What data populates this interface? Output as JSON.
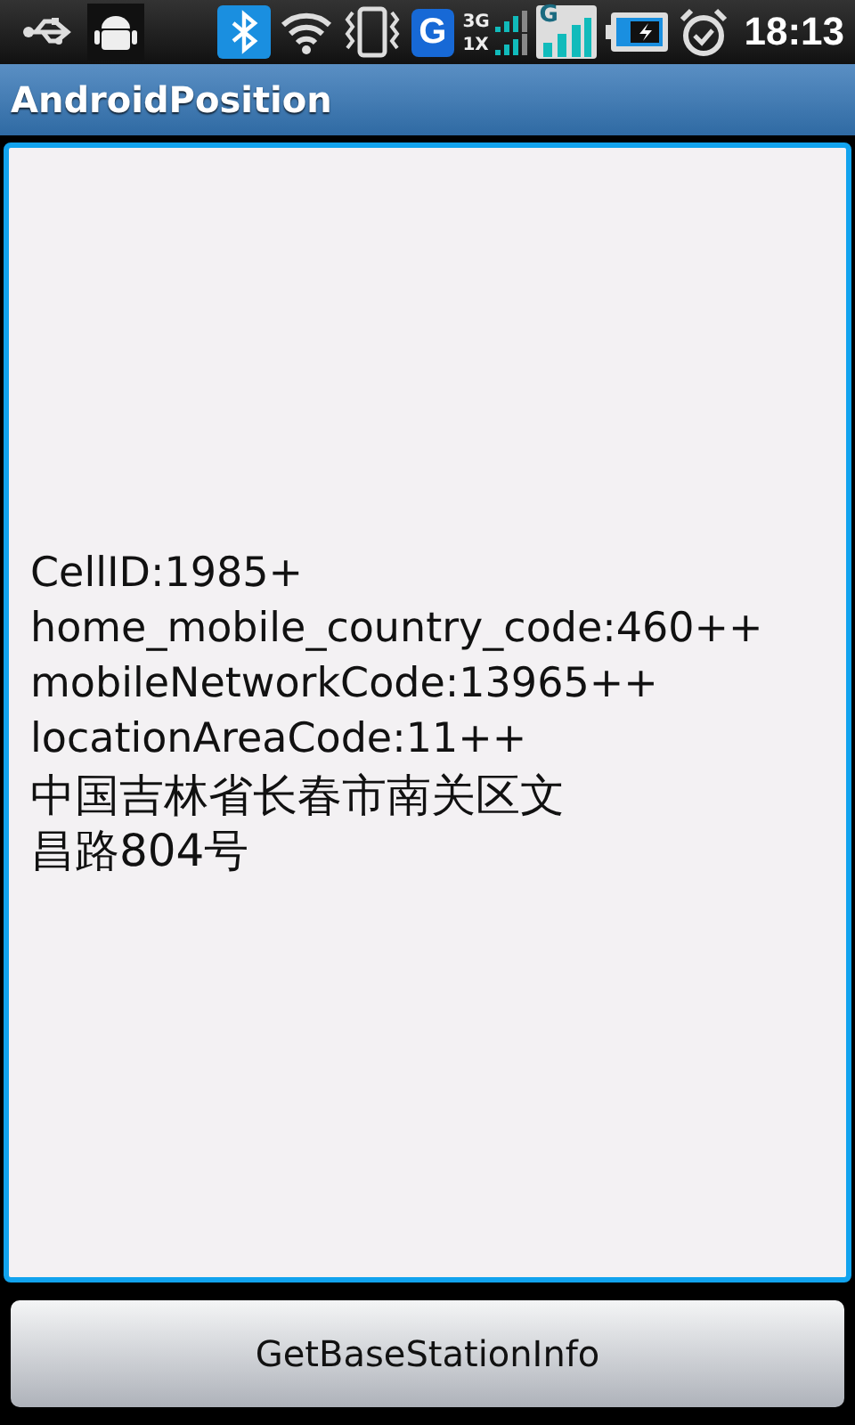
{
  "status_bar": {
    "network_labels": [
      "3G",
      "1X"
    ],
    "app_badge": "G",
    "signal_badge": "G",
    "time": "18:13"
  },
  "window": {
    "title": "AndroidPosition"
  },
  "info_text": {
    "focused": true,
    "lines": [
      "CellID:1985+",
      "home_mobile_country_code:460++",
      "mobileNetworkCode:13965++",
      "locationAreaCode:11++",
      "中国吉林省长春市南关区文昌路804号"
    ]
  },
  "buttons": [
    "GetBaseStationInfo"
  ]
}
